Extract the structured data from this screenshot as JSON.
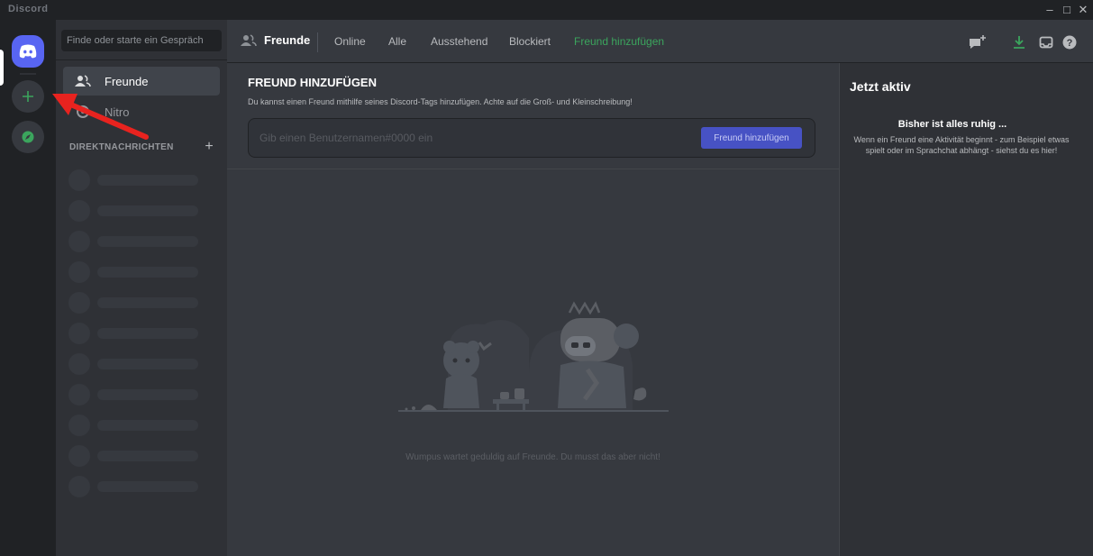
{
  "window": {
    "title": "Discord",
    "minimize": "–",
    "maximize": "□",
    "close": "✕"
  },
  "rail": {
    "home_icon": "discord-logo-icon",
    "add_icon": "plus-icon",
    "explore_icon": "compass-icon"
  },
  "sidebar": {
    "search_placeholder": "Finde oder starte ein Gespräch",
    "items": [
      {
        "label": "Freunde",
        "icon": "friends-icon"
      },
      {
        "label": "Nitro",
        "icon": "nitro-icon"
      }
    ],
    "dm_header": "DIREKTNACHRICHTEN",
    "dm_add": "+"
  },
  "header": {
    "title": "Freunde",
    "tabs": [
      {
        "label": "Online"
      },
      {
        "label": "Alle"
      },
      {
        "label": "Ausstehend"
      },
      {
        "label": "Blockiert"
      },
      {
        "label": "Freund hinzufügen"
      }
    ],
    "icons": [
      "new-group-dm-icon",
      "download-icon",
      "inbox-icon",
      "help-icon"
    ]
  },
  "add_friend": {
    "title": "FREUND HINZUFÜGEN",
    "description": "Du kannst einen Freund mithilfe seines Discord-Tags hinzufügen. Achte auf die Groß- und Kleinschreibung!",
    "placeholder": "Gib einen Benutzernamen#0000 ein",
    "button": "Freund hinzufügen"
  },
  "empty_state": {
    "text": "Wumpus wartet geduldig auf Freunde. Du musst das aber nicht!"
  },
  "activity": {
    "title": "Jetzt aktiv",
    "subtitle": "Bisher ist alles ruhig ...",
    "body": "Wenn ein Freund eine Aktivität beginnt - zum Beispiel etwas spielt oder im Sprachchat abhängt - siehst du es hier!"
  },
  "colors": {
    "blurple": "#5865f2",
    "green": "#3ba55d",
    "annotation_arrow": "#e8231f"
  }
}
